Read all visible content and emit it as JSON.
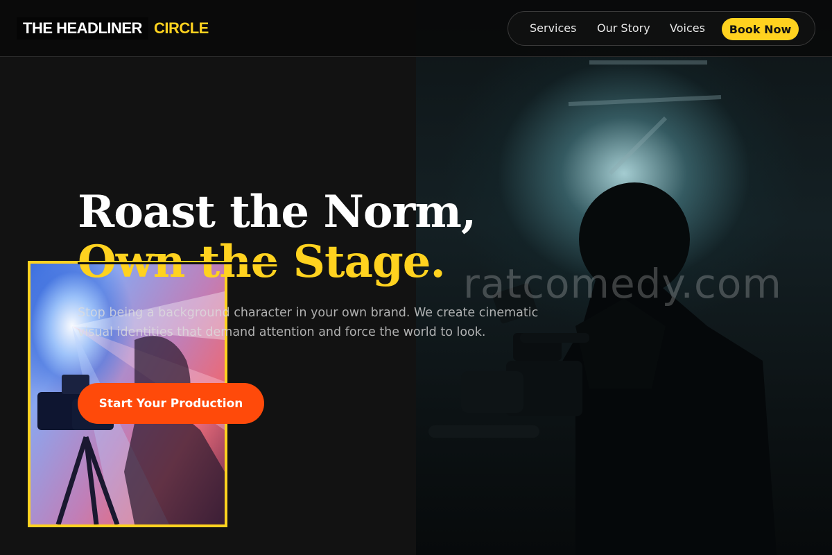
{
  "brand": {
    "name_main": "THE HEADLINER",
    "name_accent": "CIRCLE"
  },
  "nav": {
    "items": [
      {
        "label": "Services"
      },
      {
        "label": "Our Story"
      },
      {
        "label": "Voices"
      }
    ],
    "cta_label": "Book Now"
  },
  "hero": {
    "headline_line1": "Roast the Norm,",
    "headline_line2_struck": "Own the",
    "headline_line2_rest": " Stage.",
    "subtext": "Stop being a background character in your own brand. We create cinematic visual identities that demand attention and force the world to look.",
    "cta_label": "Start Your Production",
    "photo": "camera-operator-silhouette",
    "inset_photo": "camera-with-colored-light-flare"
  },
  "watermark": "ratcomedy.com",
  "colors": {
    "accent_yellow": "#ffd21f",
    "cta_orange": "#ff4a0a",
    "background": "#121212"
  }
}
